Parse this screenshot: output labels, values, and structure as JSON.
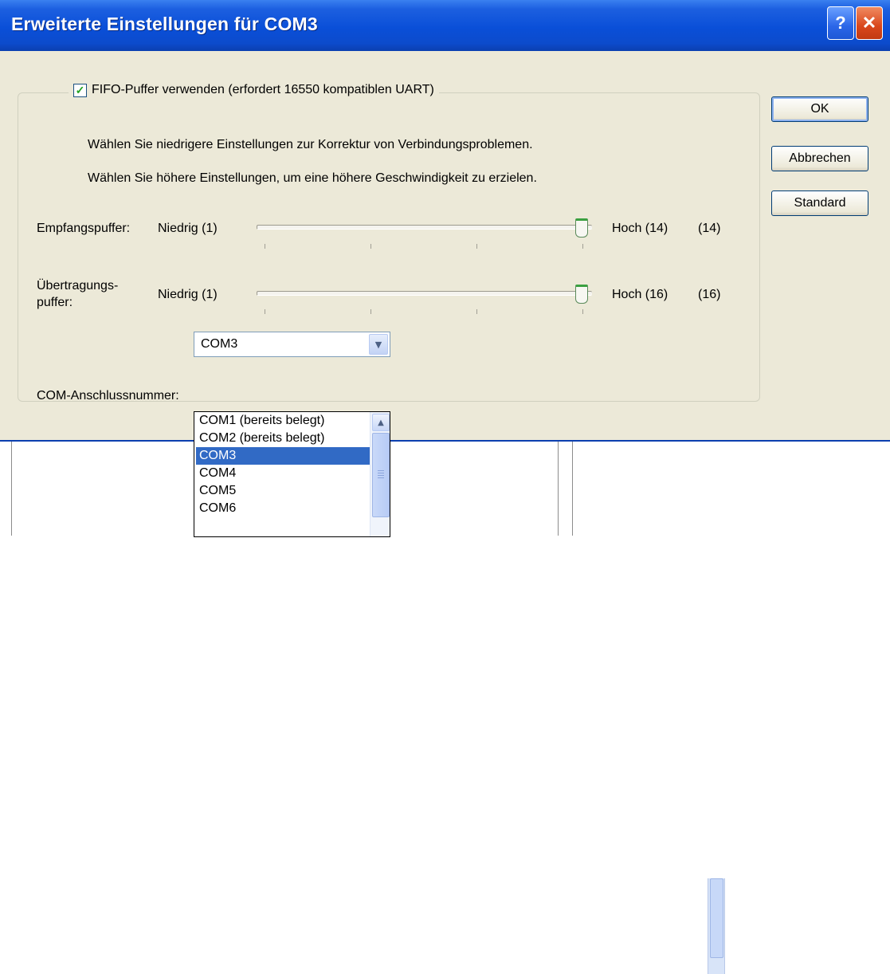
{
  "dialog": {
    "title": "Erweiterte Einstellungen für COM3",
    "help_label": "?",
    "close_label": "✕"
  },
  "fifo": {
    "checked": true,
    "label": "FIFO-Puffer verwenden (erfordert 16550 kompatiblen UART)"
  },
  "hints": {
    "lower": "Wählen Sie niedrigere Einstellungen zur Korrektur von Verbindungsproblemen.",
    "higher": "Wählen Sie höhere Einstellungen, um eine höhere Geschwindigkeit zu erzielen."
  },
  "receive_buffer": {
    "label": "Empfangspuffer:",
    "min_label": "Niedrig (1)",
    "max_label": "Hoch (14)",
    "value_label": "(14)",
    "value_fraction": 1.0
  },
  "transmit_buffer": {
    "label_line1": "Übertragungs-",
    "label_line2": "puffer:",
    "min_label": "Niedrig (1)",
    "max_label": "Hoch (16)",
    "value_label": "(16)",
    "value_fraction": 1.0
  },
  "buttons": {
    "ok": "OK",
    "cancel": "Abbrechen",
    "default": "Standard"
  },
  "com_port": {
    "label": "COM-Anschlussnummer:",
    "value": "COM3",
    "options": [
      "COM1 (bereits belegt)",
      "COM2 (bereits belegt)",
      "COM3",
      "COM4",
      "COM5",
      "COM6"
    ],
    "selected_index": 2
  },
  "colors": {
    "title_bar": "#0a4fd8",
    "dialog_bg": "#ece9d8",
    "selection": "#316ac5",
    "check": "#21a121"
  }
}
